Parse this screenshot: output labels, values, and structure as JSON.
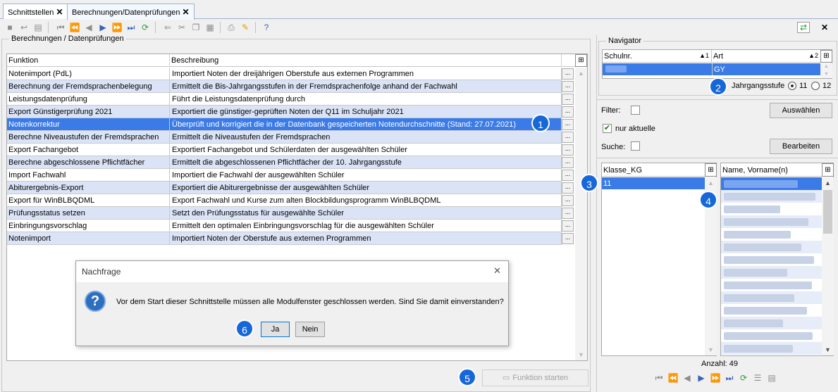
{
  "tabs": [
    {
      "label": "Schnittstellen",
      "close": "✕"
    },
    {
      "label": "Berechnungen/Datenprüfungen",
      "close": "✕"
    }
  ],
  "left_group": {
    "title": "Berechnungen / Datenprüfungen"
  },
  "grid": {
    "columns": [
      "Funktion",
      "Beschreibung"
    ],
    "row_button": "...",
    "rows": [
      {
        "funktion": "Notenimport (PdL)",
        "beschreibung": "Importiert Noten der dreijährigen Oberstufe aus externen Programmen"
      },
      {
        "funktion": "Berechnung der Fremdsprachenbelegung",
        "beschreibung": "Ermittelt die Bis-Jahrgangsstufen in der Fremdsprachenfolge anhand der Fachwahl"
      },
      {
        "funktion": "Leistungsdatenprüfung",
        "beschreibung": "Führt die Leistungsdatenprüfung durch"
      },
      {
        "funktion": "Export Günstigerprüfung 2021",
        "beschreibung": "Exportiert die günstiger-geprüften Noten der Q11 im Schuljahr 2021"
      },
      {
        "funktion": "Notenkorrektur",
        "beschreibung": "Überprüft und korrigiert die in der Datenbank gespeicherten Notendurchschnitte (Stand: 27.07.2021)"
      },
      {
        "funktion": "Berechne Niveaustufen der Fremdsprachen",
        "beschreibung": "Ermittelt die Niveaustufen der Fremdsprachen"
      },
      {
        "funktion": "Export Fachangebot",
        "beschreibung": "Exportiert Fachangebot und Schülerdaten der ausgewählten Schüler"
      },
      {
        "funktion": "Berechne abgeschlossene Pflichtfächer",
        "beschreibung": "Ermittelt die abgeschlossenen Pflichtfächer der 10. Jahrgangsstufe"
      },
      {
        "funktion": "Import Fachwahl",
        "beschreibung": "Importiert die Fachwahl der ausgewählten Schüler"
      },
      {
        "funktion": "Abiturergebnis-Export",
        "beschreibung": "Exportiert die Abiturergebnisse der ausgewählten Schüler"
      },
      {
        "funktion": "Export für WinBLBQDML",
        "beschreibung": "Export Fachwahl und Kurse zum alten Blockbildungsprogramm WinBLBQDML"
      },
      {
        "funktion": "Prüfungsstatus setzen",
        "beschreibung": "Setzt den Prüfungsstatus für ausgewählte Schüler"
      },
      {
        "funktion": "Einbringungsvorschlag",
        "beschreibung": "Ermittelt den optimalen Einbringungsvorschlag für die ausgewählten Schüler"
      },
      {
        "funktion": "Notenimport",
        "beschreibung": "Importiert Noten der Oberstufe aus externen Programmen"
      }
    ],
    "selected_row": 4
  },
  "start_button": "Funktion starten",
  "navigator": {
    "title": "Navigator",
    "col_schulnr": "Schulnr.",
    "col_schulnr_sort": "▲1",
    "col_art": "Art",
    "col_art_sort": "▲2",
    "art_value": "GY",
    "jahrgang_label": "Jahrgangsstufe",
    "options": [
      "11",
      "12"
    ],
    "selected_option": "11"
  },
  "filter_label": "Filter:",
  "nur_aktuelle_label": "nur aktuelle",
  "suche_label": "Suche:",
  "auswaehlen_button": "Auswählen",
  "bearbeiten_button": "Bearbeiten",
  "klasse": {
    "header": "Klasse_KG",
    "value": "11"
  },
  "namen": {
    "header": "Name, Vorname(n)"
  },
  "anzahl": "Anzahl: 49",
  "dialog": {
    "title": "Nachfrage",
    "message": "Vor dem Start dieser Schnittstelle müssen alle Modulfenster geschlossen werden. Sind Sie damit einverstanden?",
    "yes": "Ja",
    "no": "Nein",
    "close": "✕"
  },
  "badges": [
    "1",
    "2",
    "3",
    "4",
    "5",
    "6"
  ]
}
